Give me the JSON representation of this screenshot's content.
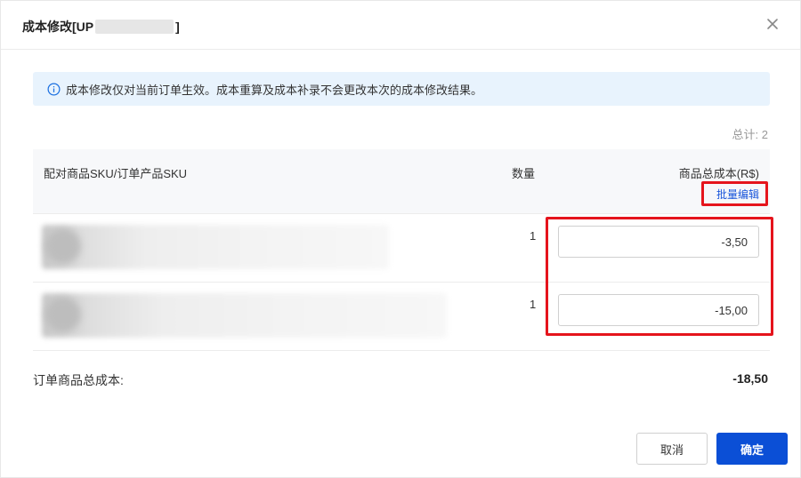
{
  "dialog": {
    "title_prefix": "成本修改[UP",
    "title_suffix": "]",
    "close_icon": "close-icon"
  },
  "notice": {
    "icon": "info-icon",
    "text": "成本修改仅对当前订单生效。成本重算及成本补录不会更改本次的成本修改结果。"
  },
  "total_count": "总计: 2",
  "table": {
    "headers": {
      "sku": "配对商品SKU/订单产品SKU",
      "quantity": "数量",
      "cost": "商品总成本(R$)"
    },
    "batch_edit_label": "批量编辑",
    "rows": [
      {
        "quantity": "1",
        "cost": "-3,50"
      },
      {
        "quantity": "1",
        "cost": "-15,00"
      }
    ]
  },
  "summary": {
    "label": "订单商品总成本:",
    "value": "-18,50"
  },
  "footer": {
    "cancel_label": "取消",
    "confirm_label": "确定"
  },
  "colors": {
    "primary": "#0b4fd6",
    "highlight": "#e5141c",
    "notice_bg": "#e8f3fd"
  }
}
